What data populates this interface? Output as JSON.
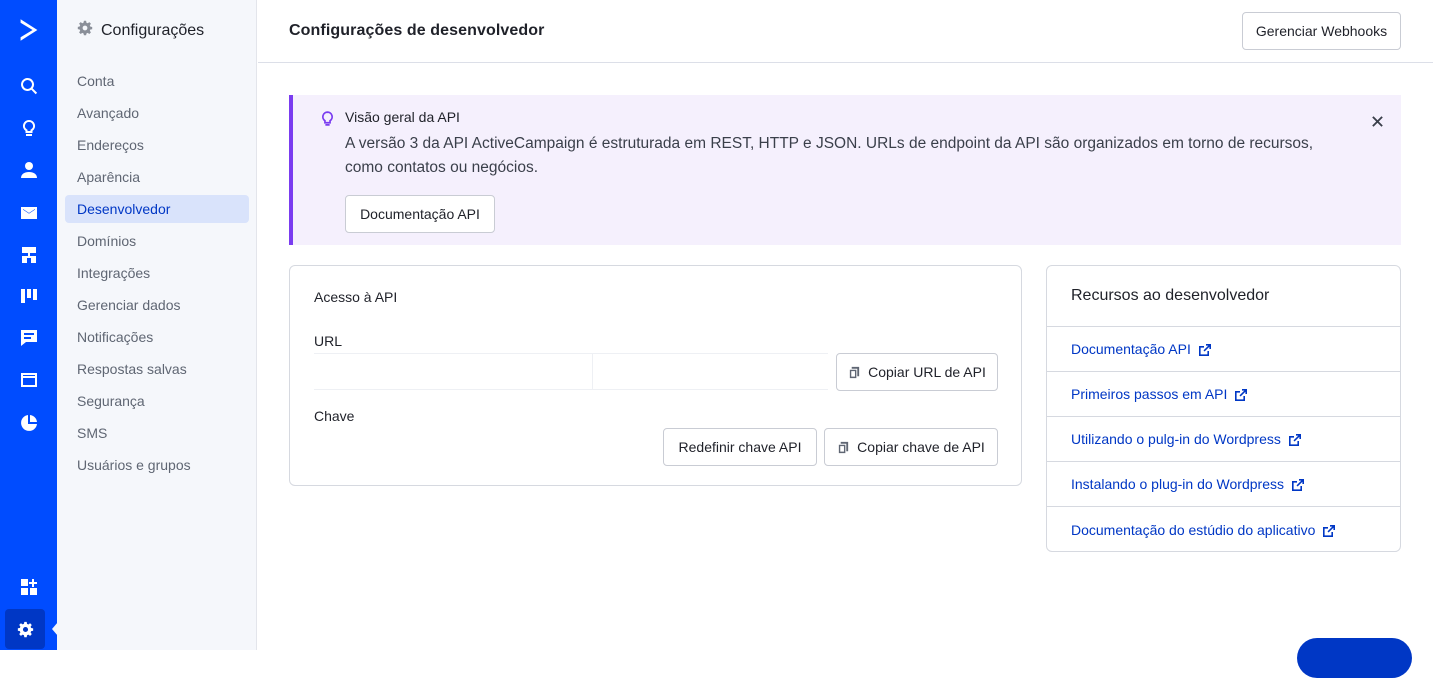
{
  "rail": {
    "items": [
      {
        "icon": "search-icon"
      },
      {
        "icon": "lightbulb-icon"
      },
      {
        "icon": "contacts-icon"
      },
      {
        "icon": "mail-icon"
      },
      {
        "icon": "automation-icon"
      },
      {
        "icon": "pipeline-icon"
      },
      {
        "icon": "conversations-icon"
      },
      {
        "icon": "website-icon"
      },
      {
        "icon": "reports-icon"
      },
      {
        "icon": "apps-add-icon"
      },
      {
        "icon": "settings-icon",
        "active": true
      }
    ],
    "brand_color": "#004cff"
  },
  "sidebar": {
    "title": "Configurações",
    "items": [
      {
        "label": "Conta"
      },
      {
        "label": "Avançado"
      },
      {
        "label": "Endereços"
      },
      {
        "label": "Aparência"
      },
      {
        "label": "Desenvolvedor",
        "active": true
      },
      {
        "label": "Domínios"
      },
      {
        "label": "Integrações"
      },
      {
        "label": "Gerenciar dados"
      },
      {
        "label": "Notificações"
      },
      {
        "label": "Respostas salvas"
      },
      {
        "label": "Segurança"
      },
      {
        "label": "SMS"
      },
      {
        "label": "Usuários e grupos"
      }
    ]
  },
  "header": {
    "title": "Configurações de desenvolvedor",
    "webhooks_label": "Gerenciar Webhooks"
  },
  "banner": {
    "title": "Visão geral da API",
    "text": "A versão 3 da API ActiveCampaign é estruturada em REST, HTTP e JSON. URLs de endpoint da API são organizados em torno de recursos, como contatos ou negócios.",
    "button_label": "Documentação API",
    "accent_color": "#7a3cf0"
  },
  "api_access": {
    "heading": "Acesso à API",
    "url_label": "URL",
    "url_value": "",
    "copy_url_label": "Copiar URL de API",
    "key_label": "Chave",
    "reset_key_label": "Redefinir chave API",
    "copy_key_label": "Copiar chave de API"
  },
  "resources": {
    "heading": "Recursos ao desenvolvedor",
    "links": [
      {
        "label": "Documentação API"
      },
      {
        "label": "Primeiros passos em API"
      },
      {
        "label": "Utilizando o pulg-in do Wordpress"
      },
      {
        "label": "Instalando o plug-in do Wordpress"
      },
      {
        "label": "Documentação do estúdio do aplicativo"
      }
    ],
    "link_color": "#0037c5"
  }
}
